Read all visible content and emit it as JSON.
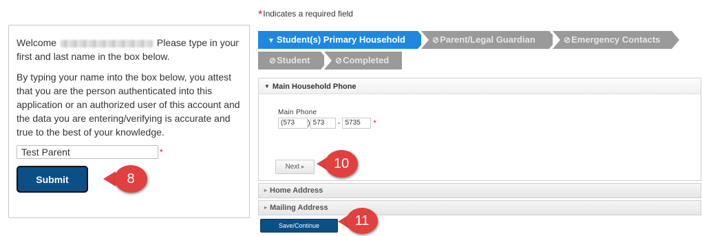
{
  "required_note": {
    "star": "*",
    "text": "Indicates a required field"
  },
  "steps": [
    {
      "label": "Student(s) Primary Household",
      "icon": "▼",
      "state": "active"
    },
    {
      "label": "Parent/Legal Guardian",
      "icon": "⊘",
      "state": "disabled"
    },
    {
      "label": "Emergency Contacts",
      "icon": "⊘",
      "state": "disabled"
    },
    {
      "label": "Student",
      "icon": "⊘",
      "state": "disabled"
    },
    {
      "label": "Completed",
      "icon": "⊘",
      "state": "disabled"
    }
  ],
  "left_panel": {
    "welcome_prefix": "Welcome",
    "welcome_suffix": " Please type in your first and last name in the box below.",
    "attest": "By typing your name into the box below, you attest that you are the person authenticated into this application or an authorized user of this account and the data you are entering/verifying is accurate and true to the best of your knowledge.",
    "name_value": "Test Parent",
    "required_star": "*",
    "submit_label": "Submit"
  },
  "phone_section": {
    "title": "Main Household Phone",
    "field_label": "Main Phone",
    "area_open": "(",
    "area_code": "573",
    "area_close": ")",
    "prefix": "573",
    "dash": "-",
    "line": "5735",
    "required_star": "*",
    "next_label": "Next",
    "next_icon": "▸"
  },
  "collapsed_sections": [
    {
      "title": "Home Address"
    },
    {
      "title": "Mailing Address"
    }
  ],
  "save_label": "Save/Continue",
  "callouts": [
    "8",
    "10",
    "11"
  ],
  "colors": {
    "active_step": "#1e88e0",
    "inactive_step": "#9a9a9a",
    "primary_button": "#0b4f87",
    "callout": "#e2403f",
    "required": "#dd1122"
  }
}
